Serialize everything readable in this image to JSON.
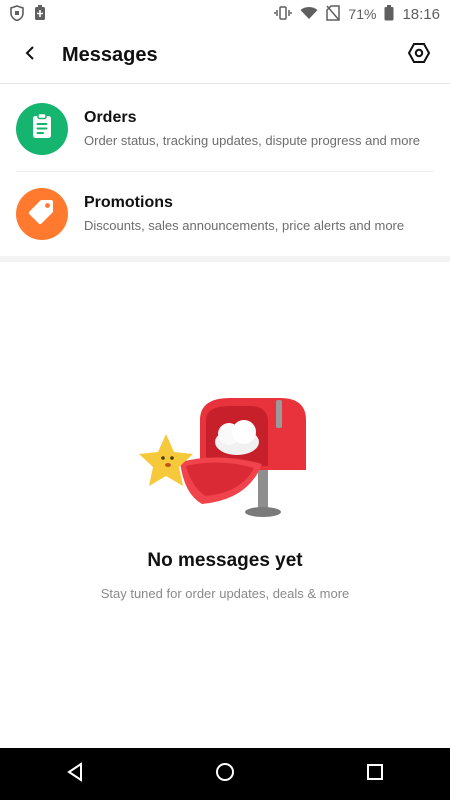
{
  "status_bar": {
    "battery_percent": "71%",
    "time": "18:16",
    "icons": [
      "shield-icon",
      "battery-saver-icon",
      "vibrate-icon",
      "wifi-icon",
      "no-sim-icon",
      "battery-icon"
    ]
  },
  "header": {
    "title": "Messages",
    "back_icon": "back-arrow-icon",
    "settings_icon": "settings-hexagon-icon"
  },
  "channels": [
    {
      "title": "Orders",
      "description": "Order status, tracking updates, dispute progress and more",
      "icon": "clipboard-icon",
      "color": "#16b56f"
    },
    {
      "title": "Promotions",
      "description": "Discounts, sales announcements, price alerts and more",
      "icon": "tag-icon",
      "color": "#ff7a2f"
    }
  ],
  "empty_state": {
    "title": "No messages yet",
    "subtitle": "Stay tuned for order updates, deals & more",
    "illustration": "mailbox-with-star-illustration"
  },
  "nav_bar": {
    "icons": [
      "nav-back-icon",
      "nav-home-icon",
      "nav-recents-icon"
    ]
  },
  "colors": {
    "accent_red": "#e8333d",
    "star_yellow": "#f6c93a"
  }
}
